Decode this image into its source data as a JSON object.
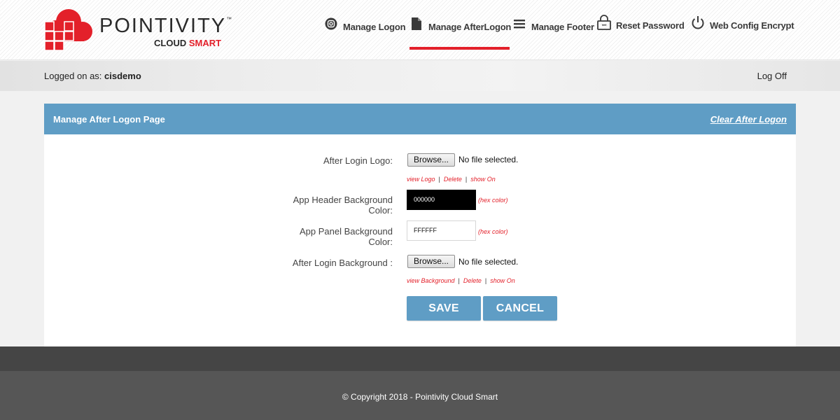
{
  "brand": {
    "name": "POINTIVITY",
    "tm": "™",
    "sub_cloud": "CLOUD",
    "sub_smart": "SMART",
    "accent_color": "#e3202a"
  },
  "nav": {
    "items": [
      {
        "label": "Manage Logon",
        "icon": "instagram-icon"
      },
      {
        "label": "Manage AfterLogon",
        "icon": "document-icon",
        "active": true
      },
      {
        "label": "Manage Footer",
        "icon": "menu-lines-icon"
      },
      {
        "label": "Reset Password",
        "icon": "lock-password-icon"
      },
      {
        "label": "Web Config Encrypt",
        "icon": "power-icon"
      }
    ]
  },
  "session": {
    "logged_label": "Logged on as:",
    "username": "cisdemo",
    "logoff": "Log Off"
  },
  "panel": {
    "title": "Manage After Logon Page",
    "clear_link": "Clear After Logon",
    "header_color": "#5f9dc5"
  },
  "form": {
    "logo": {
      "label": "After Login Logo:",
      "browse": "Browse...",
      "status": "No file selected.",
      "links": [
        "view Logo",
        "Delete",
        "show On"
      ]
    },
    "header_bg": {
      "label_line1": "App Header Background",
      "label_line2": "Color:",
      "value": "000000",
      "hint": "(hex color)"
    },
    "panel_bg": {
      "label_line1": "App Panel Background",
      "label_line2": "Color:",
      "value": "FFFFFF",
      "hint": "(hex color)"
    },
    "background": {
      "label": "After Login Background :",
      "browse": "Browse...",
      "status": "No file selected.",
      "links": [
        "view Background",
        "Delete",
        "show On"
      ]
    },
    "save": "SAVE",
    "cancel": "CANCEL"
  },
  "footer": {
    "copyright": "© Copyright 2018 - Pointivity Cloud Smart"
  }
}
